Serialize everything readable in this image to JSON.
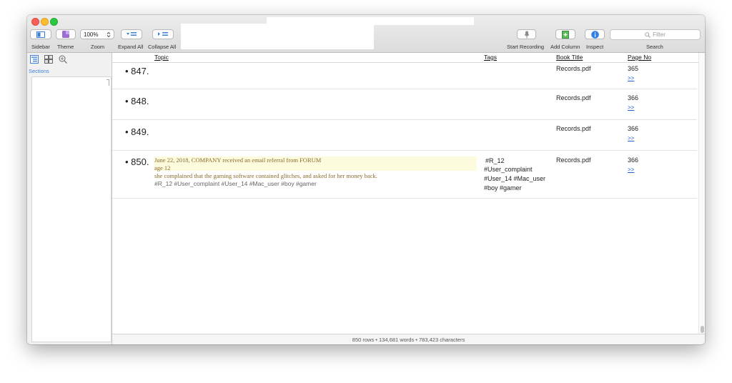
{
  "toolbar": {
    "sidebar_label": "Sidebar",
    "theme_label": "Theme",
    "zoom_value": "100%",
    "zoom_label": "Zoom",
    "expand_all_label": "Expand All",
    "collapse_all_label": "Collapse All",
    "start_recording_label": "Start Recording",
    "add_column_label": "Add Column",
    "inspect_label": "Inspect",
    "filter_placeholder": "Filter",
    "search_label": "Search"
  },
  "sidebar": {
    "sections_label": "Sections"
  },
  "table": {
    "columns": [
      "Topic",
      "Tags",
      "Book Title",
      "Page No"
    ],
    "rows": [
      {
        "number": "847.",
        "book": "Records.pdf",
        "page": "365",
        "link": ">>"
      },
      {
        "number": "848.",
        "book": "Records.pdf",
        "page": "366",
        "link": ">>"
      },
      {
        "number": "849.",
        "book": "Records.pdf",
        "page": "366",
        "link": ">>"
      },
      {
        "number": "850.",
        "note_line1": "June 22, 2018, COMPANY received an email referral from FORUM",
        "note_line2": "age 12",
        "note_line3": "she complained that the gaming software contained glitches, and asked for her money back.",
        "note_tags": "#R_12 #User_complaint #User_14 #Mac_user #boy #gamer",
        "tags_line1": "#R_12",
        "tags_line2": "#User_complaint",
        "tags_line3": "#User_14 #Mac_user",
        "tags_line4": "#boy #gamer",
        "book": "Records.pdf",
        "page": "366",
        "link": ">>"
      }
    ]
  },
  "status": {
    "summary": "850 rows • 134,681 words • 783,423 characters"
  },
  "colors": {
    "accent": "#3c7fd6",
    "link": "#1f5fd0",
    "highlight": "#fdfbde"
  }
}
